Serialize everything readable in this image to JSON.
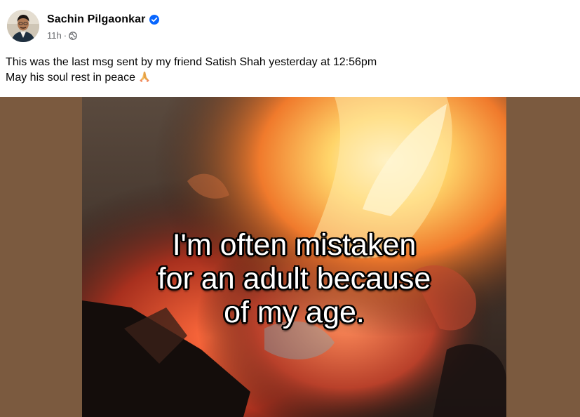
{
  "post": {
    "author": "Sachin Pilgaonkar",
    "verified": true,
    "timestamp": "11h",
    "separator": "·",
    "privacy_icon": "globe-icon",
    "caption_line1": "This was the last msg sent by my friend Satish Shah yesterday at 12:56pm",
    "caption_line2": "May his soul rest in peace",
    "caption_emoji": "folded-hands-icon"
  },
  "video": {
    "overlay_line1": "I'm often mistaken",
    "overlay_line2": "for an adult because",
    "overlay_line3": "of my age."
  },
  "colors": {
    "verified_blue": "#0866ff",
    "secondary_text": "#65676b",
    "media_backdrop": "#7b5a3f"
  }
}
